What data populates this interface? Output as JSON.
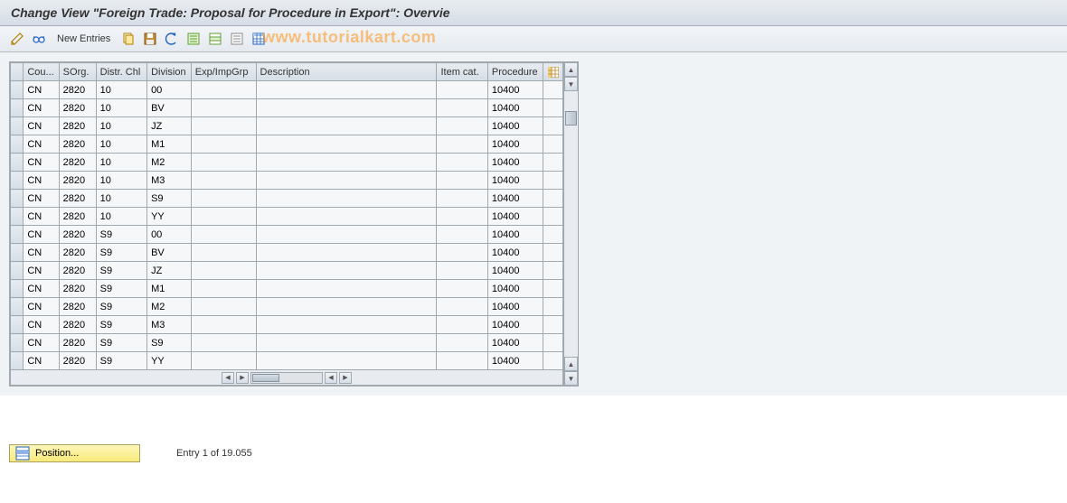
{
  "header": {
    "title": "Change View \"Foreign Trade: Proposal for Procedure in Export\": Overvie"
  },
  "toolbar": {
    "new_entries_label": "New Entries"
  },
  "watermark": "www.tutorialkart.com",
  "table": {
    "columns": [
      "Cou...",
      "SOrg.",
      "Distr. Chl",
      "Division",
      "Exp/ImpGrp",
      "Description",
      "Item cat.",
      "Procedure"
    ],
    "rows": [
      {
        "cou": "CN",
        "sorg": "2820",
        "distr": "10",
        "div": "00",
        "exp": "",
        "desc": "",
        "item": "",
        "proc": "10400"
      },
      {
        "cou": "CN",
        "sorg": "2820",
        "distr": "10",
        "div": "BV",
        "exp": "",
        "desc": "",
        "item": "",
        "proc": "10400"
      },
      {
        "cou": "CN",
        "sorg": "2820",
        "distr": "10",
        "div": "JZ",
        "exp": "",
        "desc": "",
        "item": "",
        "proc": "10400"
      },
      {
        "cou": "CN",
        "sorg": "2820",
        "distr": "10",
        "div": "M1",
        "exp": "",
        "desc": "",
        "item": "",
        "proc": "10400"
      },
      {
        "cou": "CN",
        "sorg": "2820",
        "distr": "10",
        "div": "M2",
        "exp": "",
        "desc": "",
        "item": "",
        "proc": "10400"
      },
      {
        "cou": "CN",
        "sorg": "2820",
        "distr": "10",
        "div": "M3",
        "exp": "",
        "desc": "",
        "item": "",
        "proc": "10400"
      },
      {
        "cou": "CN",
        "sorg": "2820",
        "distr": "10",
        "div": "S9",
        "exp": "",
        "desc": "",
        "item": "",
        "proc": "10400"
      },
      {
        "cou": "CN",
        "sorg": "2820",
        "distr": "10",
        "div": "YY",
        "exp": "",
        "desc": "",
        "item": "",
        "proc": "10400"
      },
      {
        "cou": "CN",
        "sorg": "2820",
        "distr": "S9",
        "div": "00",
        "exp": "",
        "desc": "",
        "item": "",
        "proc": "10400"
      },
      {
        "cou": "CN",
        "sorg": "2820",
        "distr": "S9",
        "div": "BV",
        "exp": "",
        "desc": "",
        "item": "",
        "proc": "10400"
      },
      {
        "cou": "CN",
        "sorg": "2820",
        "distr": "S9",
        "div": "JZ",
        "exp": "",
        "desc": "",
        "item": "",
        "proc": "10400"
      },
      {
        "cou": "CN",
        "sorg": "2820",
        "distr": "S9",
        "div": "M1",
        "exp": "",
        "desc": "",
        "item": "",
        "proc": "10400"
      },
      {
        "cou": "CN",
        "sorg": "2820",
        "distr": "S9",
        "div": "M2",
        "exp": "",
        "desc": "",
        "item": "",
        "proc": "10400"
      },
      {
        "cou": "CN",
        "sorg": "2820",
        "distr": "S9",
        "div": "M3",
        "exp": "",
        "desc": "",
        "item": "",
        "proc": "10400"
      },
      {
        "cou": "CN",
        "sorg": "2820",
        "distr": "S9",
        "div": "S9",
        "exp": "",
        "desc": "",
        "item": "",
        "proc": "10400"
      },
      {
        "cou": "CN",
        "sorg": "2820",
        "distr": "S9",
        "div": "YY",
        "exp": "",
        "desc": "",
        "item": "",
        "proc": "10400"
      }
    ]
  },
  "footer": {
    "position_label": "Position...",
    "status": "Entry 1 of 19.055"
  }
}
